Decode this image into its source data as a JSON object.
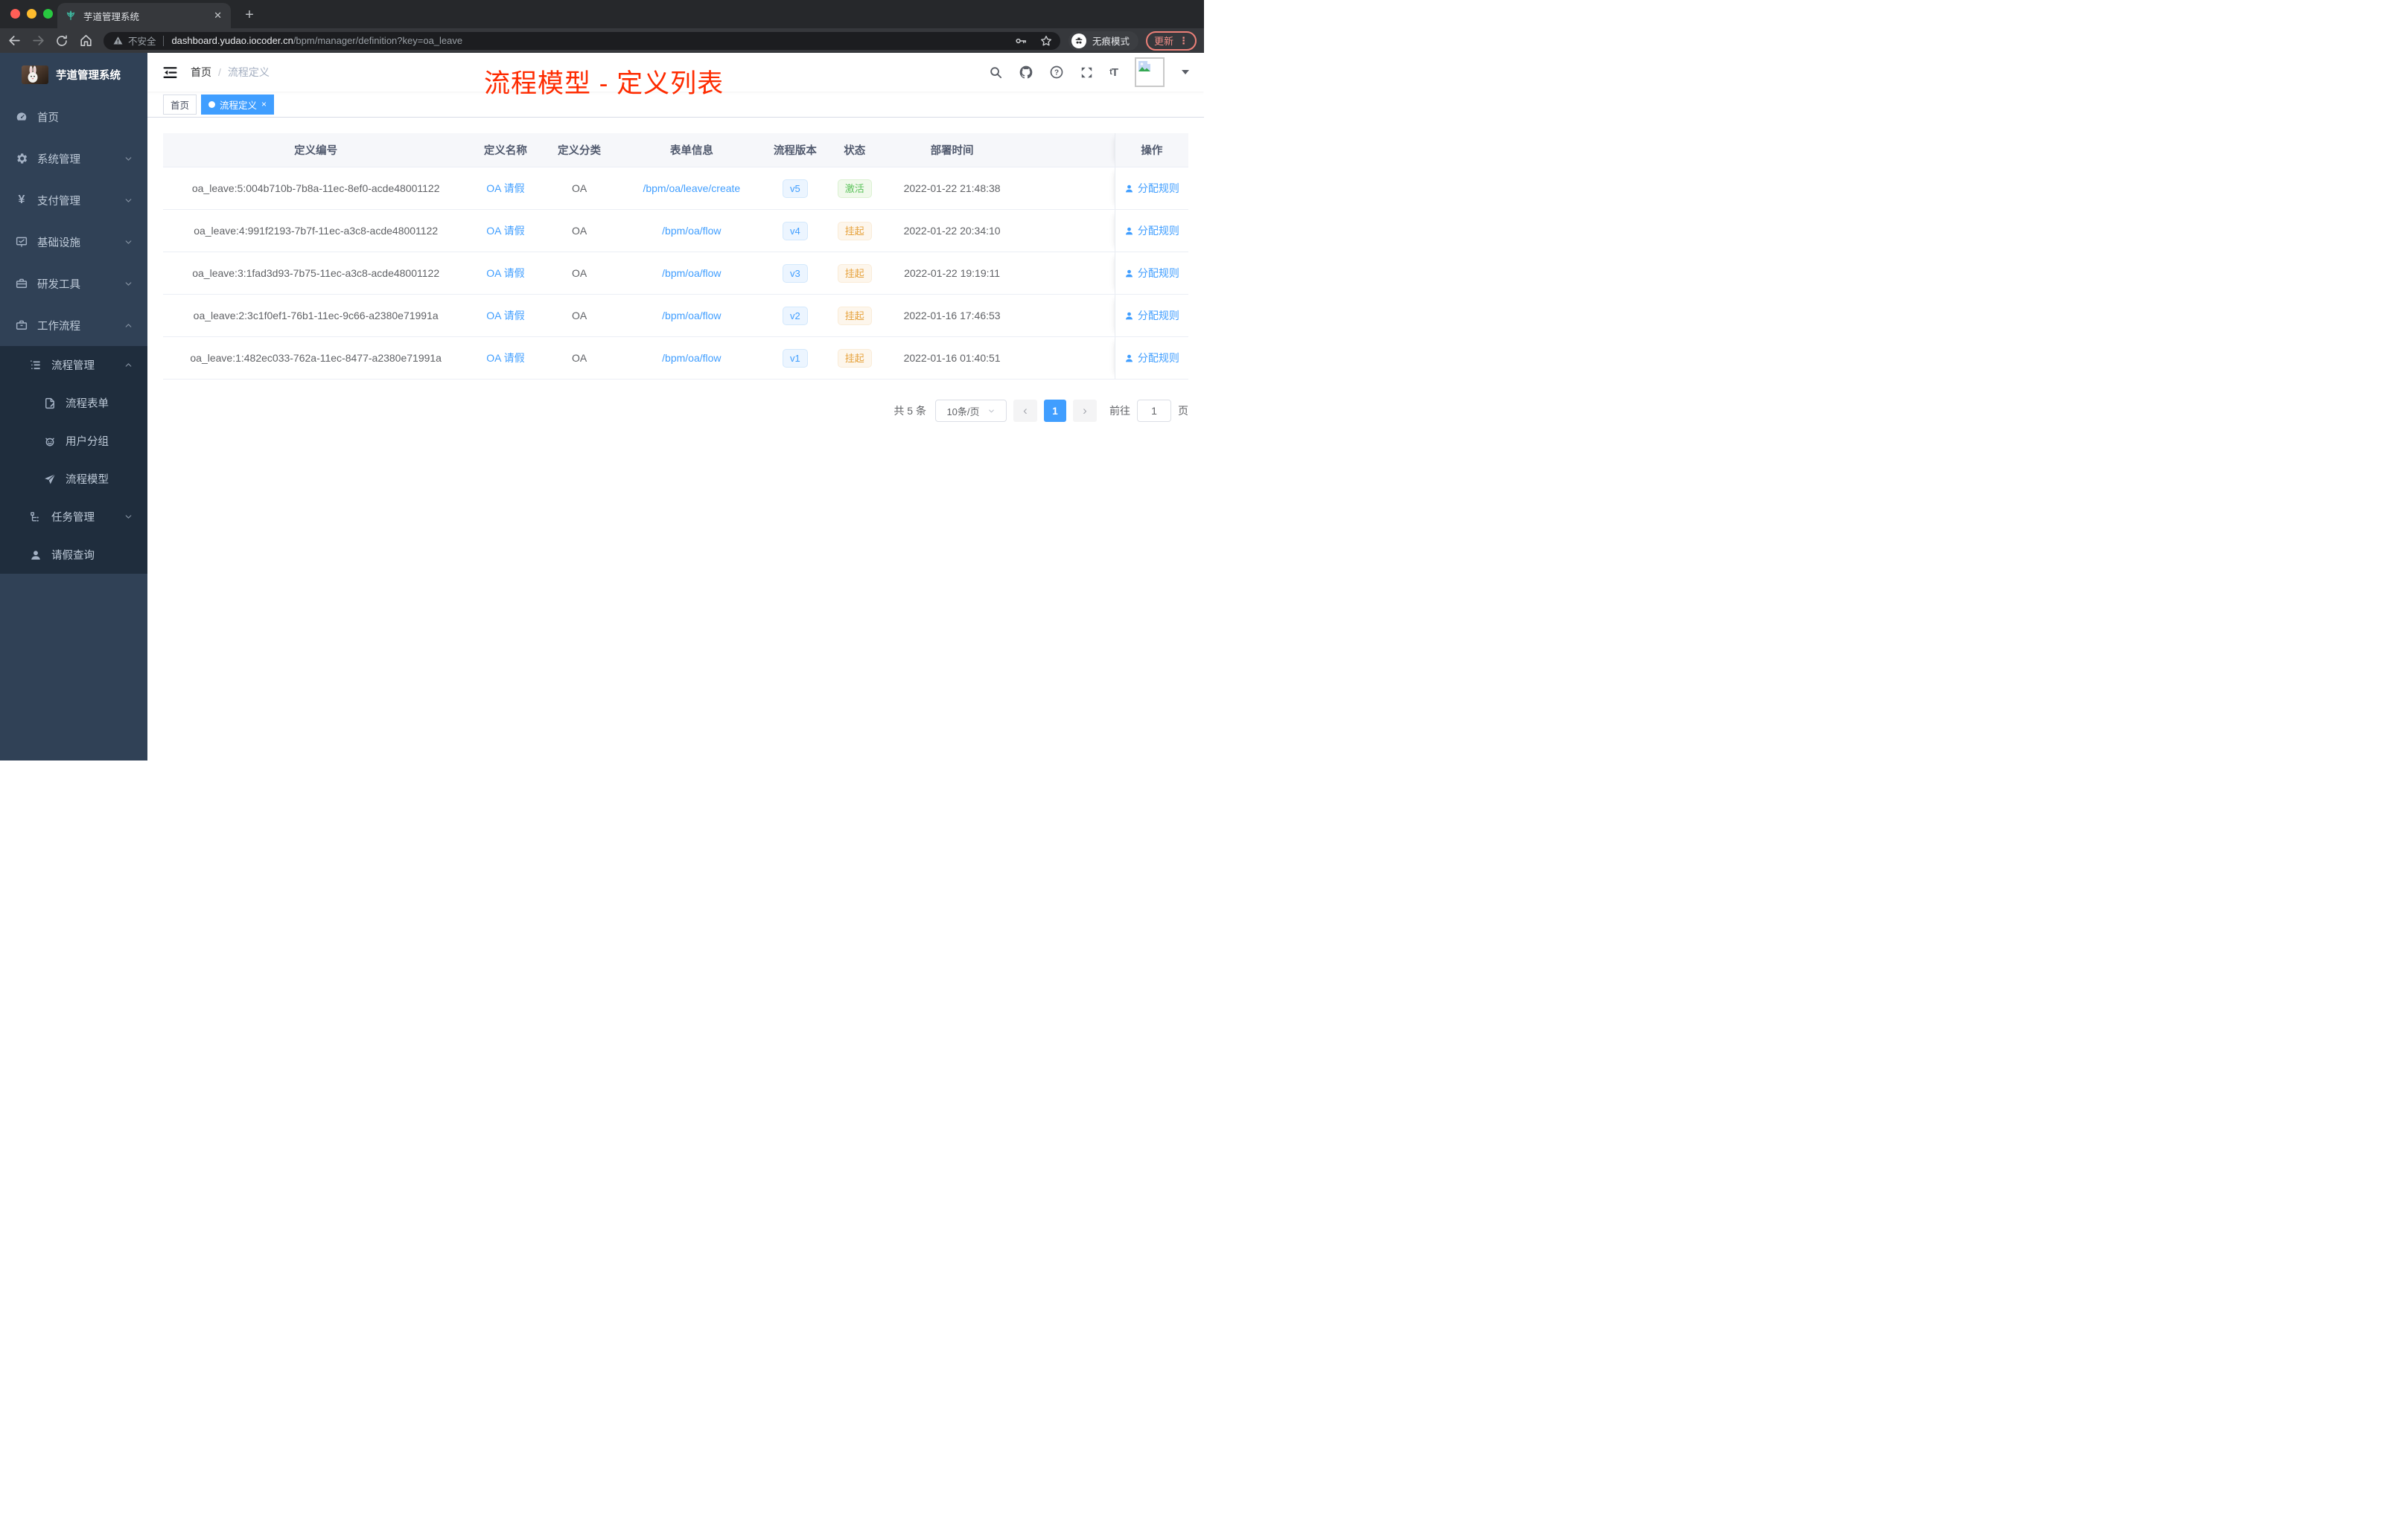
{
  "colors": {
    "accent": "#409eff",
    "title-red": "#fe2b00",
    "success": "#5ac25a",
    "warning": "#e6a23c",
    "update-red": "#f08d86",
    "sidebar-bg": "#304156",
    "submenu-bg": "#1f2d3d",
    "favicon-teal": "#3eb8a0"
  },
  "browser": {
    "tab_title": "芋道管理系统",
    "close_glyph": "✕",
    "new_tab_glyph": "+",
    "security_label": "不安全",
    "url_host": "dashboard.yudao.iocoder.cn",
    "url_path": "/bpm/manager/definition?key=oa_leave",
    "incognito_label": "无痕模式",
    "update_label": "更新",
    "menu_dots_glyph": "⋮"
  },
  "sidebar": {
    "logo_title": "芋道管理系统",
    "items": [
      {
        "label": "首页"
      },
      {
        "label": "系统管理"
      },
      {
        "label": "支付管理"
      },
      {
        "label": "基础设施"
      },
      {
        "label": "研发工具"
      },
      {
        "label": "工作流程"
      }
    ],
    "yen_glyph": "¥",
    "workflow": {
      "process_group": "流程管理",
      "children": [
        {
          "label": "流程表单"
        },
        {
          "label": "用户分组"
        },
        {
          "label": "流程模型"
        }
      ],
      "task_group": "任务管理",
      "leave_item": "请假查询"
    }
  },
  "navbar": {
    "breadcrumb_home": "首页",
    "breadcrumb_sep": "/",
    "breadcrumb_current": "流程定义",
    "overlay_title": "流程模型 - 定义列表",
    "font_size_glyph": "tT"
  },
  "tags": {
    "home": "首页",
    "active": "流程定义",
    "close_glyph": "×"
  },
  "table": {
    "columns": [
      "定义编号",
      "定义名称",
      "定义分类",
      "表单信息",
      "流程版本",
      "状态",
      "部署时间",
      "操作"
    ],
    "rows": [
      {
        "id": "oa_leave:5:004b710b-7b8a-11ec-8ef0-acde48001122",
        "name": "OA 请假",
        "category": "OA",
        "form": "/bpm/oa/leave/create",
        "version": "v5",
        "status": "激活",
        "status_type": "success",
        "deploy_time": "2022-01-22 21:48:38",
        "action": "分配规则"
      },
      {
        "id": "oa_leave:4:991f2193-7b7f-11ec-a3c8-acde48001122",
        "name": "OA 请假",
        "category": "OA",
        "form": "/bpm/oa/flow",
        "version": "v4",
        "status": "挂起",
        "status_type": "warning",
        "deploy_time": "2022-01-22 20:34:10",
        "action": "分配规则"
      },
      {
        "id": "oa_leave:3:1fad3d93-7b75-11ec-a3c8-acde48001122",
        "name": "OA 请假",
        "category": "OA",
        "form": "/bpm/oa/flow",
        "version": "v3",
        "status": "挂起",
        "status_type": "warning",
        "deploy_time": "2022-01-22 19:19:11",
        "action": "分配规则"
      },
      {
        "id": "oa_leave:2:3c1f0ef1-76b1-11ec-9c66-a2380e71991a",
        "name": "OA 请假",
        "category": "OA",
        "form": "/bpm/oa/flow",
        "version": "v2",
        "status": "挂起",
        "status_type": "warning",
        "deploy_time": "2022-01-16 17:46:53",
        "action": "分配规则"
      },
      {
        "id": "oa_leave:1:482ec033-762a-11ec-8477-a2380e71991a",
        "name": "OA 请假",
        "category": "OA",
        "form": "/bpm/oa/flow",
        "version": "v1",
        "status": "挂起",
        "status_type": "warning",
        "deploy_time": "2022-01-16 01:40:51",
        "action": "分配规则"
      }
    ]
  },
  "pagination": {
    "total": "共 5 条",
    "page_size": "10条/页",
    "prev_glyph": "‹",
    "page": "1",
    "next_glyph": "›",
    "goto_label": "前往",
    "goto_value": "1",
    "unit_label": "页"
  }
}
